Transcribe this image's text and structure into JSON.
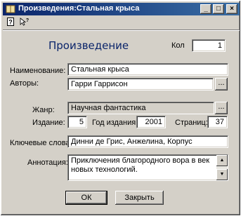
{
  "window": {
    "title": "Произведения:Стальная крыса"
  },
  "titlebar_buttons": {
    "minimize": "_",
    "maximize": "□",
    "close": "×"
  },
  "toolbar": {
    "help_icon": "help-icon",
    "whats_this_icon": "whats-this-icon"
  },
  "form": {
    "heading": "Произведение",
    "count_label": "Кол",
    "count_value": "1",
    "name_label": "Наименование:",
    "name_value": "Стальная крыса",
    "authors_label": "Авторы:",
    "authors_value": "Гарри Гаррисон",
    "browse": "...",
    "genre_label": "Жанр:",
    "genre_value": "Научная фантастика",
    "edition_label": "Издание:",
    "edition_value": "5",
    "year_label": "Год издания:",
    "year_value": "2001",
    "pages_label": "Страниц:",
    "pages_value": "37",
    "keywords_label": "Ключевые слова:",
    "keywords_value": "Динни де Грис, Анжелина, Корпус",
    "annotation_label": "Аннотация:",
    "annotation_value": "Приключения благородного вора в век новых технологий."
  },
  "buttons": {
    "ok": "ОК",
    "close": "Закрыть"
  }
}
